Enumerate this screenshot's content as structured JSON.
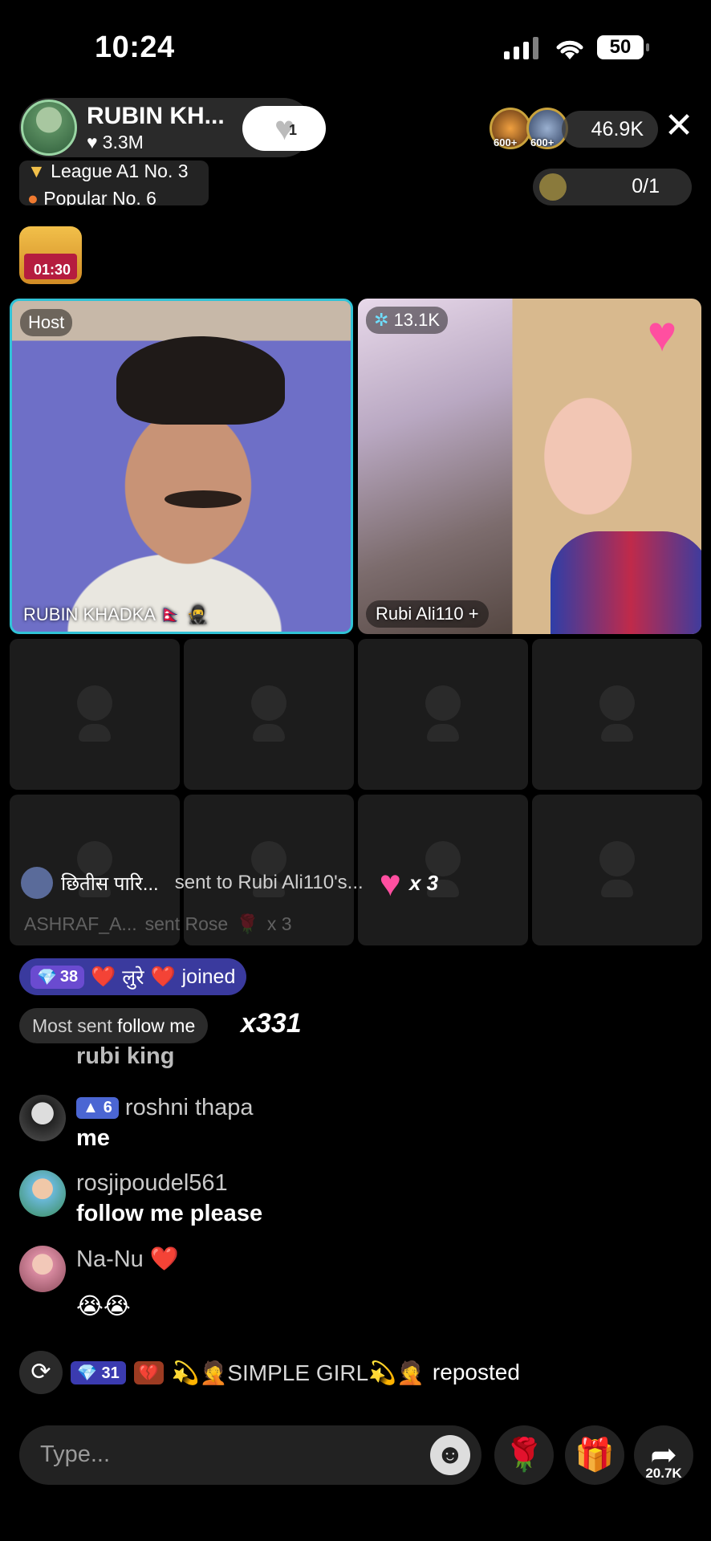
{
  "status_bar": {
    "time": "10:24",
    "battery": "50"
  },
  "header": {
    "host_name": "RUBIN  KH...",
    "host_likes": "3.3M",
    "follow_count": "1",
    "viewer_badges": [
      "600+",
      "600+"
    ],
    "viewer_count": "46.9K",
    "league_line1": "League A1 No. 3",
    "league_line2": "Popular No. 6",
    "goal_progress": "0/1",
    "treasure_timer": "01:30"
  },
  "host_tile": {
    "badge": "Host",
    "name": "RUBIN  KHADKA"
  },
  "guest_tile": {
    "badge": "13.1K",
    "name": "Rubi Ali110"
  },
  "gift_banner": {
    "sender": "छितीस पारि...",
    "text": "sent to Rubi Ali110's...",
    "count": "x 3",
    "faded_sender": "ASHRAF_A...",
    "faded_text": "sent Rose",
    "faded_count": "x 3"
  },
  "joined": {
    "level": "38",
    "name": "लुरे",
    "suffix": "joined"
  },
  "most_sent": {
    "prefix": "Most sent",
    "item": "follow me",
    "count": "x331"
  },
  "chat": [
    {
      "user": "",
      "message": "rubi king"
    },
    {
      "user": "roshni thapa",
      "rank": "6",
      "message": "me"
    },
    {
      "user": "rosjipoudel561",
      "message": "follow me please"
    },
    {
      "user": "Na-Nu",
      "message": "😭😭"
    }
  ],
  "repost": {
    "level": "31",
    "user": "💫🤦SIMPLE GIRL💫🤦",
    "action": "reposted"
  },
  "composer": {
    "placeholder": "Type...",
    "share_count": "20.7K"
  },
  "colors": {
    "host_border": "#31c2d6",
    "joined_bg": "#3a3a9e",
    "accent_red": "#e8223b"
  }
}
